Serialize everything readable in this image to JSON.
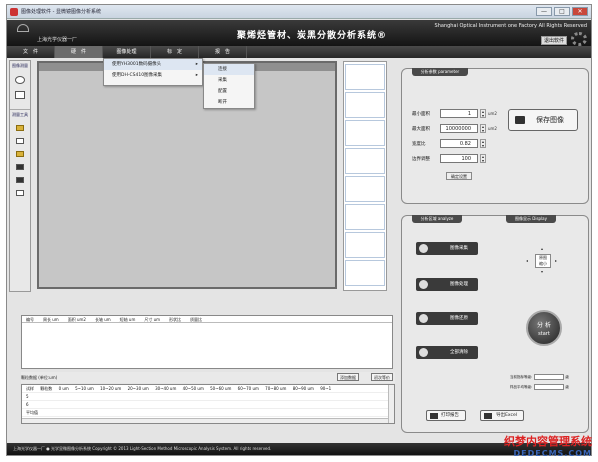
{
  "window": {
    "title": "图像处理软件 - 显微镜图像分析系统",
    "buttons": [
      "—",
      "□",
      "✕"
    ]
  },
  "header": {
    "company": "上海光学仪器一厂",
    "app_title": "聚烯烃管材、炭黑分散分析系统®",
    "factory_en": "Shanghai Optical Instrument one Factory All Rights Reserved",
    "exit_label": "退出软件"
  },
  "menu": {
    "items": [
      "文　件",
      "硬　件",
      "图像处理",
      "标　定",
      "报　告"
    ],
    "hardware_dropdown": [
      {
        "label": "使用YH3001数码摄像头",
        "arrow": "▸"
      },
      {
        "label": "使用DH-CS410图像采集",
        "arrow": "▸"
      }
    ],
    "submenu": [
      "连接",
      "采集",
      "配置",
      "断开"
    ]
  },
  "left_tools": {
    "top_label": "图像测量",
    "mid_label": "测量工具"
  },
  "params": {
    "title": "分析参数 parameter",
    "rows": [
      {
        "label": "最小面积",
        "value": "1",
        "unit": "um2"
      },
      {
        "label": "最大面积",
        "value": "10000000",
        "unit": "um2"
      },
      {
        "label": "宽度比",
        "value": "0.82",
        "unit": ""
      },
      {
        "label": "边界调整",
        "value": "100",
        "unit": ""
      }
    ],
    "set_button": "确定设置",
    "save_button": "保存图像"
  },
  "analysis": {
    "title": "分析区域 analyze",
    "display_title": "图像显示 Display",
    "buttons": [
      "图像采集",
      "图像处理",
      "图像还原",
      "全部清除"
    ],
    "dirpad": {
      "up": "放大",
      "center_top": "原图",
      "center_bottom": "缩小"
    },
    "start_main": "分 析",
    "start_sub": "start",
    "grade_labels": [
      "当前指标等级:",
      "样品平均等级:"
    ],
    "grade_suffix": "级",
    "print_button": "打印报告",
    "export_button": "导出Excel"
  },
  "table1": {
    "headers": [
      "编号",
      "周长 um",
      "面积 um2",
      "长轴 um",
      "短轴 um",
      "尺寸 um",
      "形状比",
      "质量比"
    ]
  },
  "stats": {
    "title": "颗粒数据 (单位:um)",
    "add_button": "添加数据",
    "clear_button": "初次等价",
    "header": [
      "试样",
      "颗粒数",
      "0 um",
      "5~10 um",
      "10~20 um",
      "20~30 um",
      "30~40 um",
      "40~50 um",
      "50~60 um",
      "60~70 um",
      "70~80 um",
      "80~90 um",
      "90~1"
    ],
    "rows": [
      "5",
      "6",
      "平均值"
    ]
  },
  "status": "上海光学仪器一厂 ● 光学显微图像分析系统  Copyright © 2013 Light-Section Method Microscopic Analysis System. All rights reserved.",
  "watermark": {
    "line1": "织梦内容管理系统",
    "line2": "DEDECMS.COM"
  }
}
